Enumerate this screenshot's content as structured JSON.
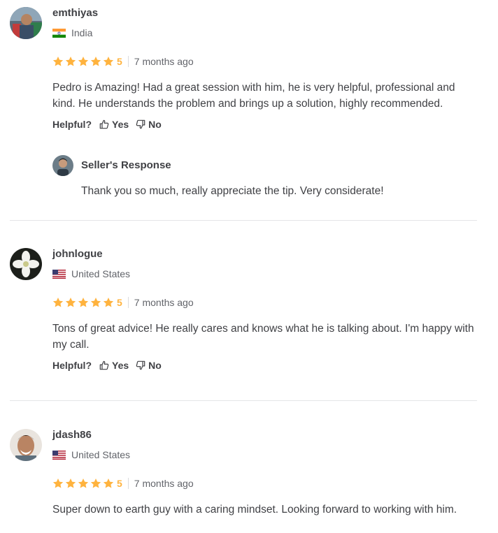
{
  "colors": {
    "star": "#ffb33e",
    "text": "#404145",
    "muted": "#62646a",
    "divider": "#e4e5e7"
  },
  "reviews": [
    {
      "username": "emthiyas",
      "country": "India",
      "flag": "flag-india-icon",
      "rating": "5",
      "rating_value": 5,
      "time": "7 months ago",
      "text": "Pedro is Amazing! Had a great session with him, he is very helpful, professional and kind. He understands the problem and brings up a solution, highly recommended.",
      "helpful": {
        "label": "Helpful?",
        "yes": "Yes",
        "no": "No"
      },
      "seller_response": {
        "title": "Seller's Response",
        "text": "Thank you so much, really appreciate the tip. Very considerate!"
      }
    },
    {
      "username": "johnlogue",
      "country": "United States",
      "flag": "flag-us-icon",
      "rating": "5",
      "rating_value": 5,
      "time": "7 months ago",
      "text": "Tons of great advice! He really cares and knows what he is talking about. I'm happy with my call.",
      "helpful": {
        "label": "Helpful?",
        "yes": "Yes",
        "no": "No"
      }
    },
    {
      "username": "jdash86",
      "country": "United States",
      "flag": "flag-us-icon",
      "rating": "5",
      "rating_value": 5,
      "time": "7 months ago",
      "text": "Super down to earth guy with a caring mindset. Looking forward to working with him."
    }
  ]
}
